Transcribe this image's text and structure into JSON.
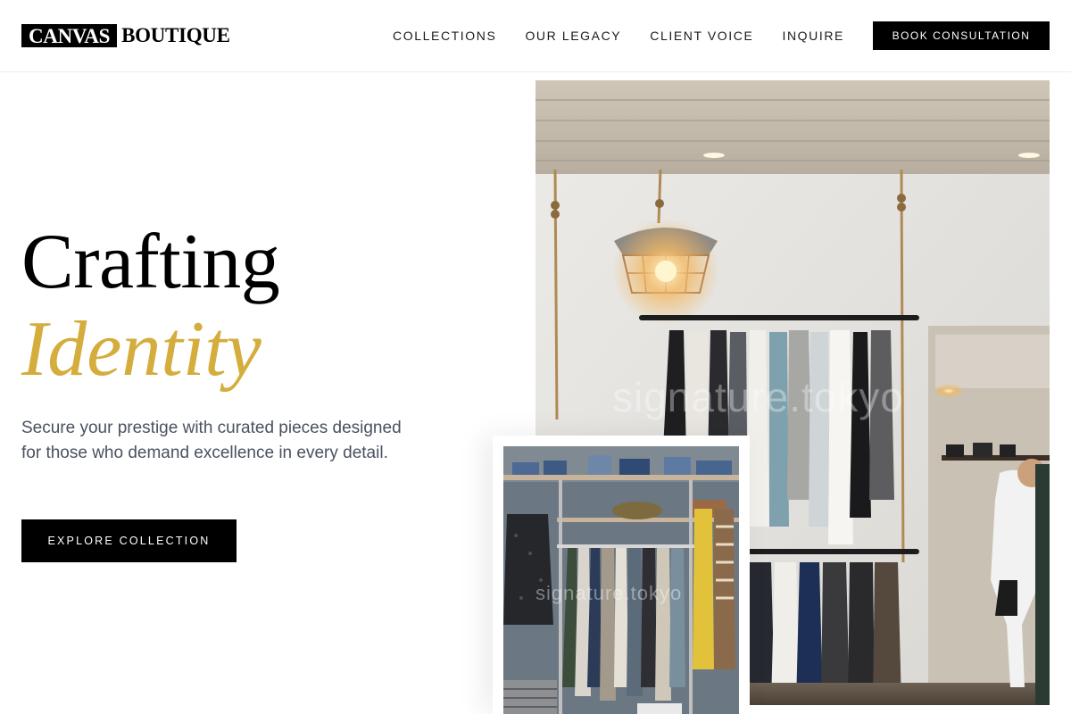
{
  "brand": {
    "logo_box": "CANVAS",
    "logo_text": "BOUTIQUE"
  },
  "nav": {
    "items": [
      {
        "label": "COLLECTIONS"
      },
      {
        "label": "OUR LEGACY"
      },
      {
        "label": "CLIENT VOICE"
      },
      {
        "label": "INQUIRE"
      }
    ],
    "cta_label": "BOOK CONSULTATION"
  },
  "hero": {
    "title_line1": "Crafting",
    "title_line2": "Identity",
    "description": "Secure your prestige with curated pieces designed for those who demand excellence in every detail.",
    "cta_label": "EXPLORE COLLECTION"
  },
  "images": {
    "main": {
      "subject": "boutique interior with hanging clothing rack and pendant lamp",
      "watermark": "signature.tokyo"
    },
    "secondary": {
      "subject": "closet shelving with dresses and folded denim",
      "watermark": "signature.tokyo"
    }
  },
  "colors": {
    "accent_gold": "#d4ad3c",
    "primary_black": "#000000",
    "body_text": "#4a5160"
  }
}
